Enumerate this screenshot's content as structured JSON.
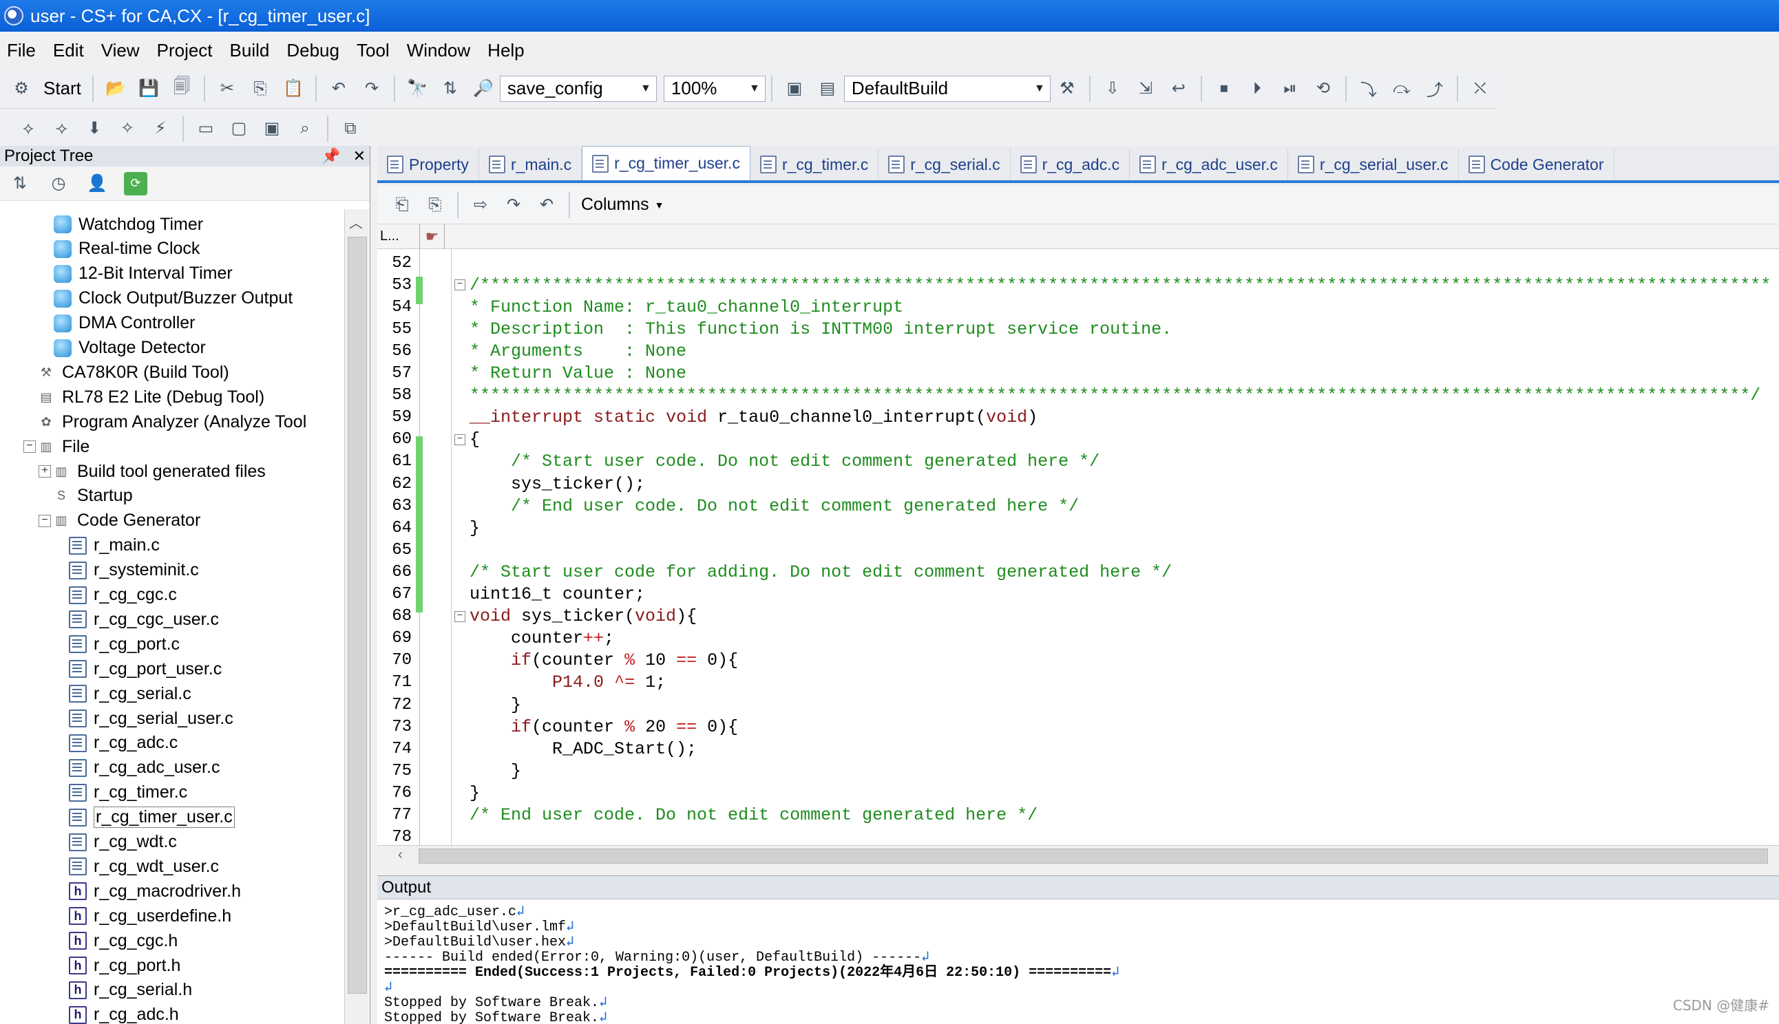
{
  "window": {
    "title": "user - CS+ for CA,CX - [r_cg_timer_user.c]"
  },
  "menu": [
    "File",
    "Edit",
    "View",
    "Project",
    "Build",
    "Debug",
    "Tool",
    "Window",
    "Help"
  ],
  "toolbar": {
    "start_label": "Start",
    "config_combo": "save_config",
    "zoom_combo": "100%",
    "build_combo": "DefaultBuild"
  },
  "project_tree": {
    "title": "Project Tree",
    "pin_glyph": "📌",
    "close_glyph": "✕",
    "items": [
      {
        "label": "Watchdog Timer",
        "icon": "peripheral-icon"
      },
      {
        "label": "Real-time Clock",
        "icon": "peripheral-icon"
      },
      {
        "label": "12-Bit Interval Timer",
        "icon": "peripheral-icon"
      },
      {
        "label": "Clock Output/Buzzer Output",
        "icon": "peripheral-icon"
      },
      {
        "label": "DMA Controller",
        "icon": "peripheral-icon"
      },
      {
        "label": "Voltage Detector",
        "icon": "peripheral-icon"
      },
      {
        "label": "CA78K0R (Build Tool)",
        "icon": "build-tool-icon"
      },
      {
        "label": "RL78 E2 Lite (Debug Tool)",
        "icon": "debug-tool-icon"
      },
      {
        "label": "Program Analyzer (Analyze Tool",
        "icon": "analyzer-icon"
      },
      {
        "label": "File",
        "icon": "folder-icon",
        "expander": "−"
      },
      {
        "label": "Build tool generated files",
        "icon": "folder-icon",
        "expander": "+"
      },
      {
        "label": "Startup",
        "icon": "startup-icon"
      },
      {
        "label": "Code Generator",
        "icon": "folder-icon",
        "expander": "−"
      },
      {
        "label": "r_main.c",
        "icon": "c-file-icon"
      },
      {
        "label": "r_systeminit.c",
        "icon": "c-file-icon"
      },
      {
        "label": "r_cg_cgc.c",
        "icon": "c-file-icon"
      },
      {
        "label": "r_cg_cgc_user.c",
        "icon": "c-file-icon"
      },
      {
        "label": "r_cg_port.c",
        "icon": "c-file-icon"
      },
      {
        "label": "r_cg_port_user.c",
        "icon": "c-file-icon"
      },
      {
        "label": "r_cg_serial.c",
        "icon": "c-file-icon"
      },
      {
        "label": "r_cg_serial_user.c",
        "icon": "c-file-icon"
      },
      {
        "label": "r_cg_adc.c",
        "icon": "c-file-icon"
      },
      {
        "label": "r_cg_adc_user.c",
        "icon": "c-file-icon"
      },
      {
        "label": "r_cg_timer.c",
        "icon": "c-file-icon"
      },
      {
        "label": "r_cg_timer_user.c",
        "icon": "c-file-icon",
        "selected": true
      },
      {
        "label": "r_cg_wdt.c",
        "icon": "c-file-icon"
      },
      {
        "label": "r_cg_wdt_user.c",
        "icon": "c-file-icon"
      },
      {
        "label": "r_cg_macrodriver.h",
        "icon": "h-file-icon"
      },
      {
        "label": "r_cg_userdefine.h",
        "icon": "h-file-icon"
      },
      {
        "label": "r_cg_cgc.h",
        "icon": "h-file-icon"
      },
      {
        "label": "r_cg_port.h",
        "icon": "h-file-icon"
      },
      {
        "label": "r_cg_serial.h",
        "icon": "h-file-icon"
      },
      {
        "label": "r_cg_adc.h",
        "icon": "h-file-icon"
      }
    ]
  },
  "tabs": [
    {
      "label": "Property",
      "active": false
    },
    {
      "label": "r_main.c",
      "active": false
    },
    {
      "label": "r_cg_timer_user.c",
      "active": true
    },
    {
      "label": "r_cg_timer.c",
      "active": false
    },
    {
      "label": "r_cg_serial.c",
      "active": false
    },
    {
      "label": "r_cg_adc.c",
      "active": false
    },
    {
      "label": "r_cg_adc_user.c",
      "active": false
    },
    {
      "label": "r_cg_serial_user.c",
      "active": false
    },
    {
      "label": "Code Generator",
      "active": false
    }
  ],
  "editor": {
    "columns_label": "Columns",
    "line_header": "L...",
    "lines": [
      {
        "n": "52",
        "text": ""
      },
      {
        "n": "53",
        "text": "/*****************************************************************************************************************************",
        "cls": "c-comment",
        "fold": "−"
      },
      {
        "n": "54",
        "text": "* Function Name: r_tau0_channel0_interrupt",
        "cls": "c-comment"
      },
      {
        "n": "55",
        "text": "* Description  : This function is INTTM00 interrupt service routine.",
        "cls": "c-comment"
      },
      {
        "n": "56",
        "text": "* Arguments    : None",
        "cls": "c-comment"
      },
      {
        "n": "57",
        "text": "* Return Value : None",
        "cls": "c-comment"
      },
      {
        "n": "58",
        "text": "****************************************************************************************************************************/",
        "cls": "c-comment"
      },
      {
        "n": "59",
        "text": "__interrupt static void r_tau0_channel0_interrupt(void)",
        "cls": "c-kw"
      },
      {
        "n": "60",
        "text": "{",
        "cls": "c-plain",
        "fold": "−"
      },
      {
        "n": "61",
        "text": "    /* Start user code. Do not edit comment generated here */",
        "cls": "c-comment"
      },
      {
        "n": "62",
        "text": "    sys_ticker();",
        "cls": "c-plain"
      },
      {
        "n": "63",
        "text": "    /* End user code. Do not edit comment generated here */",
        "cls": "c-comment"
      },
      {
        "n": "64",
        "text": "}",
        "cls": "c-plain"
      },
      {
        "n": "65",
        "text": ""
      },
      {
        "n": "66",
        "text": "/* Start user code for adding. Do not edit comment generated here */",
        "cls": "c-comment"
      },
      {
        "n": "67",
        "text": "uint16_t counter;",
        "cls": "c-plain"
      },
      {
        "n": "68",
        "text": "void sys_ticker(void){",
        "cls": "c-mixed-void",
        "fold": "−"
      },
      {
        "n": "69",
        "text": "    counter++;",
        "cls": "c-plain"
      },
      {
        "n": "70",
        "text": "    if(counter % 10 == 0){",
        "cls": "c-if"
      },
      {
        "n": "71",
        "text": "        P14.0 ^= 1;",
        "cls": "c-reg"
      },
      {
        "n": "72",
        "text": "    }",
        "cls": "c-plain"
      },
      {
        "n": "73",
        "text": "    if(counter % 20 == 0){",
        "cls": "c-if"
      },
      {
        "n": "74",
        "text": "        R_ADC_Start();",
        "cls": "c-plain"
      },
      {
        "n": "75",
        "text": "    }",
        "cls": "c-plain"
      },
      {
        "n": "76",
        "text": "}",
        "cls": "c-plain"
      },
      {
        "n": "77",
        "text": "/* End user code. Do not edit comment generated here */",
        "cls": "c-comment"
      },
      {
        "n": "78",
        "text": ""
      }
    ]
  },
  "output": {
    "title": "Output",
    "lines": [
      ">r_cg_adc_user.c",
      ">DefaultBuild\\user.lmf",
      ">DefaultBuild\\user.hex",
      "------ Build ended(Error:0, Warning:0)(user, DefaultBuild) ------",
      "========== Ended(Success:1 Projects, Failed:0 Projects)(2022年4月6日 22:50:10) ==========",
      "",
      "Stopped by Software Break.",
      "Stopped by Software Break."
    ]
  },
  "watermark": "CSDN @健康#"
}
